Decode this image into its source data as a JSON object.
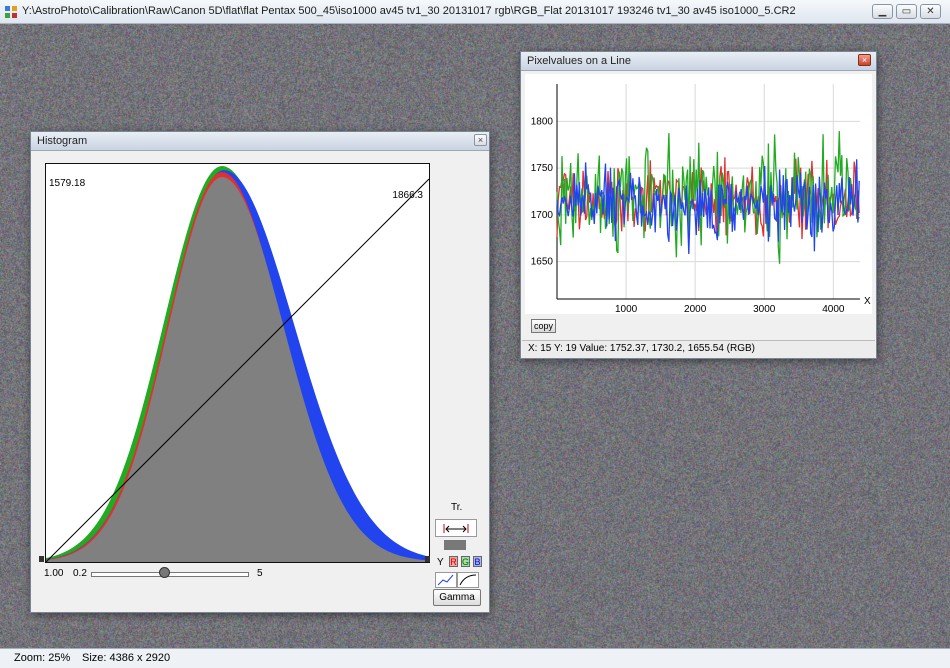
{
  "window": {
    "title": "Y:\\AstroPhoto\\Calibration\\Raw\\Canon 5D\\flat\\flat Pentax 500_45\\iso1000 av45 tv1_30 20131017 rgb\\RGB_Flat 20131017 193246 tv1_30 av45 iso1000_5.CR2",
    "icon": "app-icon",
    "controls": [
      "minimize-icon",
      "maximize-icon",
      "close-icon"
    ]
  },
  "status": {
    "zoom": "Zoom: 25%",
    "size": "Size: 4386 x 2920"
  },
  "histogram": {
    "title": "Histogram",
    "min_label": "1579.18",
    "max_label": "1866.3",
    "gamma_value": "1.00",
    "gamma_min": "0.2",
    "gamma_max": "5",
    "gamma_position": 0.47,
    "tr_label": "Tr.",
    "channel_prefix": "Y",
    "channels": [
      "R",
      "G",
      "B"
    ],
    "gamma_button": "Gamma",
    "colors": {
      "fill": "#808080",
      "red": "#e03030",
      "green": "#22aa22",
      "blue": "#2244ee"
    }
  },
  "pixel_window": {
    "title": "Pixelvalues on a Line",
    "copy_button": "copy",
    "status": "X: 15  Y: 19  Value: 1752.37, 1730.2, 1655.54 (RGB)",
    "chart_data": {
      "type": "line",
      "x_ticks": [
        "1000",
        "2000",
        "3000",
        "4000"
      ],
      "y_ticks": [
        "1800",
        "1750",
        "1700",
        "1650"
      ],
      "xlabel": "X",
      "xlim": [
        0,
        4386
      ],
      "ylim": [
        1610,
        1840
      ],
      "series": [
        {
          "color": "#e03030",
          "mean": 1718,
          "spread": 22
        },
        {
          "color": "#22aa22",
          "mean": 1716,
          "spread": 34
        },
        {
          "color": "#2244ee",
          "mean": 1712,
          "spread": 26
        }
      ]
    }
  }
}
